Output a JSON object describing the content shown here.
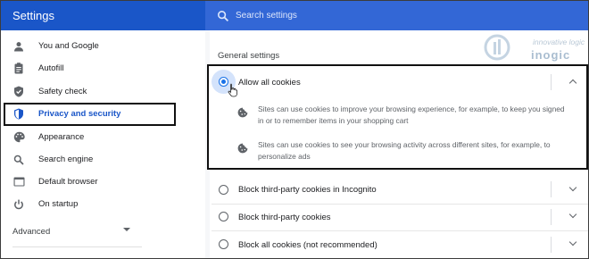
{
  "header": {
    "app_title": "Settings",
    "search_placeholder": "Search settings",
    "search_icon": "search-icon"
  },
  "sidebar": {
    "items": [
      {
        "label": "You and Google",
        "icon": "person-icon"
      },
      {
        "label": "Autofill",
        "icon": "clipboard-icon"
      },
      {
        "label": "Safety check",
        "icon": "shield-check-icon"
      },
      {
        "label": "Privacy and security",
        "icon": "shield-icon",
        "active": true
      },
      {
        "label": "Appearance",
        "icon": "palette-icon"
      },
      {
        "label": "Search engine",
        "icon": "search-icon"
      },
      {
        "label": "Default browser",
        "icon": "browser-icon"
      },
      {
        "label": "On startup",
        "icon": "power-icon"
      }
    ],
    "advanced_label": "Advanced"
  },
  "main": {
    "section_title": "General settings",
    "options": [
      {
        "label": "Allow all cookies",
        "selected": true,
        "expanded": true,
        "details": [
          "Sites can use cookies to improve your browsing experience, for example, to keep you signed in or to remember items in your shopping cart",
          "Sites can use cookies to see your browsing activity across different sites, for example, to personalize ads"
        ]
      },
      {
        "label": "Block third-party cookies in Incognito",
        "selected": false
      },
      {
        "label": "Block third-party cookies",
        "selected": false
      },
      {
        "label": "Block all cookies (not recommended)",
        "selected": false
      }
    ]
  },
  "watermark": {
    "tagline": "innovative logic",
    "wordmark": "inogic"
  },
  "colors": {
    "header_left": "#1a56c8",
    "header_right": "#3367d6",
    "accent": "#1a73e8",
    "highlight_box": "#111111"
  }
}
